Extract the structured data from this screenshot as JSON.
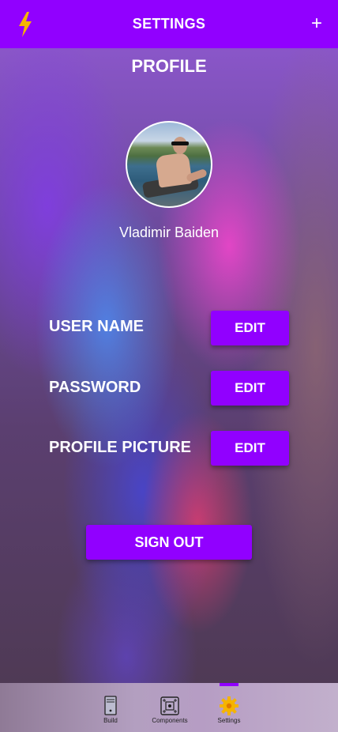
{
  "header": {
    "title": "SETTINGS",
    "left_icon": "lightning-bolt-icon",
    "right_icon": "plus-icon",
    "plus_glyph": "+"
  },
  "profile": {
    "title": "PROFILE",
    "display_name": "Vladimir Baiden"
  },
  "rows": [
    {
      "label": "USER NAME",
      "button": "EDIT"
    },
    {
      "label": "PASSWORD",
      "button": "EDIT"
    },
    {
      "label": "PROFILE PICTURE",
      "button": "EDIT"
    }
  ],
  "sign_out_label": "SIGN OUT",
  "bottom_nav": {
    "items": [
      {
        "label": "Build",
        "icon": "computer-tower-icon"
      },
      {
        "label": "Components",
        "icon": "circuit-board-icon"
      },
      {
        "label": "Settings",
        "icon": "gear-icon",
        "active": true
      }
    ]
  },
  "colors": {
    "accent": "#9100ff",
    "bolt": "#f5b400",
    "gear": "#f5b400"
  }
}
